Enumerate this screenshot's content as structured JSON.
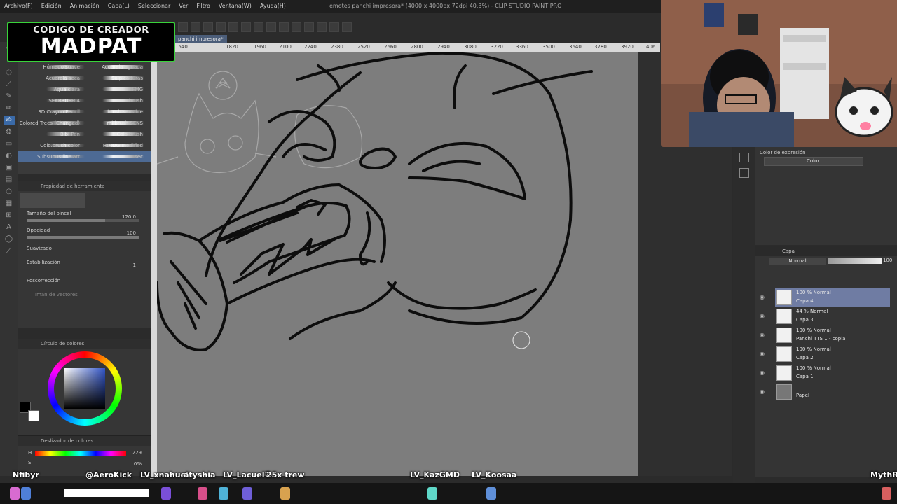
{
  "app": {
    "window_title": "emotes panchi impresora* (4000 x 4000px 72dpi 40.3%) - CLIP STUDIO PAINT PRO",
    "menu": [
      "Archivo(F)",
      "Edición",
      "Animación",
      "Capa(L)",
      "Seleccionar",
      "Ver",
      "Filtro",
      "Ventana(W)",
      "Ayuda(H)"
    ],
    "canvas_tab": "panchi impresora*"
  },
  "badge": {
    "line1": "CODIGO DE CREADOR",
    "line2": "MADPAT",
    "border_color": "#39d33a"
  },
  "brushes": {
    "left": [
      "Húmedo suave",
      "Acuarela seca",
      "Agua clara",
      "SEKBRUSH 4",
      "3D Crayon Pencil",
      "Colored Trees (Changed)",
      "Bibi Pen",
      "Colo.brush color",
      "Subsubus line art"
    ],
    "right": [
      "Acuarela aguada",
      "Salpicaduras",
      "FMG",
      "brush",
      "brush sensible",
      "mi brush SENS",
      "Colo brush",
      "HIMOG modified",
      "sec"
    ],
    "selected_index": 8
  },
  "tool_property": {
    "title": "Propiedad de herramienta",
    "brush_size_label": "Tamaño del pincel",
    "brush_size_value": "120.0",
    "opacity_label": "Opacidad",
    "opacity_value": "100",
    "smoothing_label": "Suavizado",
    "stabilization_label": "Estabilización",
    "stabilization_value": "1",
    "post_correction_label": "Poscorrección",
    "vector_label": "Imán de vectores"
  },
  "color_wheel": {
    "title": "Círculo de colores"
  },
  "color_slider": {
    "title": "Deslizador de colores",
    "h_label": "H",
    "h_value": "229",
    "s_label": "S",
    "s_value": "0%"
  },
  "ruler": {
    "ticks": [
      "1540",
      "1820",
      "1960",
      "2100",
      "2240",
      "2380",
      "2520",
      "2660",
      "2800",
      "2940",
      "3080",
      "3220",
      "3360",
      "3500",
      "3640",
      "3780",
      "3920",
      "406"
    ]
  },
  "expression_panel": {
    "title": "Color de expresión",
    "value": "Color"
  },
  "layer_panel": {
    "tab": "Capa",
    "blend_mode": "Normal",
    "opacity": "100",
    "layers": [
      {
        "mode": "100 % Normal",
        "name": "Capa 4",
        "selected": true
      },
      {
        "mode": "44 % Normal",
        "name": "Capa 3",
        "selected": false
      },
      {
        "mode": "100 % Normal",
        "name": "Panchi TTS 1 - copia",
        "selected": false
      },
      {
        "mode": "100 % Normal",
        "name": "Capa 2",
        "selected": false
      },
      {
        "mode": "100 % Normal",
        "name": "Capa 1",
        "selected": false
      },
      {
        "mode": "",
        "name": "Papel",
        "selected": false
      }
    ]
  },
  "chat_overlay": {
    "names": [
      "Nfibyr",
      "@AeroKick",
      "LV_xnahuel",
      "atyshia",
      "LV_Lacuel7",
      "25x trew",
      "LV_KazGMD",
      "LV_Koosaa",
      "MythR"
    ]
  }
}
